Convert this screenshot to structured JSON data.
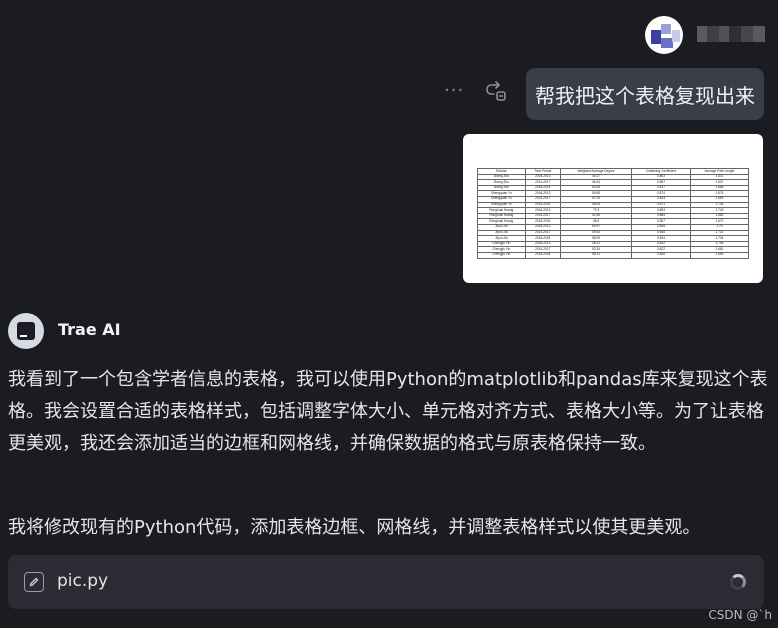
{
  "user": {
    "name_redacted": true
  },
  "user_message": {
    "text": "帮我把这个表格复现出来",
    "more_icon": "ellipsis-icon",
    "retry_icon": "retry-icon"
  },
  "attached_image": {
    "table_rows": [
      [
        "Scholar",
        "Time Period",
        "Weighted Average Degree",
        "Clustering Coefficient",
        "Average Path Length"
      ],
      [
        "Zhang Zhu",
        "2004-2013",
        "40.27",
        "0.863",
        "1.611"
      ],
      [
        "Zhang Zhu",
        "2014-2017",
        "46.44",
        "0.857",
        "1.637"
      ],
      [
        "Zhang Zhu",
        "2018-2024",
        "53.06",
        "0.817",
        "1.666"
      ],
      [
        "Shengquan Yu",
        "2004-2013",
        "55.85",
        "0.874",
        "1.674"
      ],
      [
        "Shengquan Yu",
        "2014-2017",
        "57.05",
        "0.843",
        "1.653"
      ],
      [
        "Shengquan Yu",
        "2018-2024",
        "58.09",
        "0.871",
        "1.704"
      ],
      [
        "Ronghuai Huang",
        "2004-2013",
        "79.3",
        "0.893",
        "1.743"
      ],
      [
        "Ronghuai Huang",
        "2014-2017",
        "52.96",
        "0.884",
        "1.682"
      ],
      [
        "Ronghuai Huang",
        "2018-2024",
        "48.5",
        "0.857",
        "1.672"
      ],
      [
        "Jiyou Jia",
        "2004-2013",
        "60.97",
        "0.855",
        "1.70"
      ],
      [
        "Jiyou Jia",
        "2014-2017",
        "59.53",
        "0.845",
        "1.714"
      ],
      [
        "Jiyou Jia",
        "2018-2024",
        "58.05",
        "0.834",
        "1.734"
      ],
      [
        "Chengjiu Yin",
        "2004-2013",
        "48.12",
        "0.842",
        "1.706"
      ],
      [
        "Chengjiu Yin",
        "2014-2017",
        "52.34",
        "0.822",
        "1.661"
      ],
      [
        "Chengjiu Yin",
        "2018-2024",
        "58.31",
        "0.806",
        "1.659"
      ]
    ]
  },
  "assistant": {
    "name": "Trae AI",
    "avatar_icon": "terminal-icon",
    "paragraph1": "我看到了一个包含学者信息的表格，我可以使用Python的matplotlib和pandas库来复现这个表格。我会设置合适的表格样式，包括调整字体大小、单元格对齐方式、表格大小等。为了让表格更美观，我还会添加适当的边框和网格线，并确保数据的格式与原表格保持一致。",
    "paragraph2": "我将修改现有的Python代码，添加表格边框、网格线，并调整表格样式以使其更美观。"
  },
  "file_card": {
    "icon": "edit-file-icon",
    "filename": "pic.py",
    "status_icon": "loading-spinner"
  },
  "watermark": "CSDN @`h"
}
